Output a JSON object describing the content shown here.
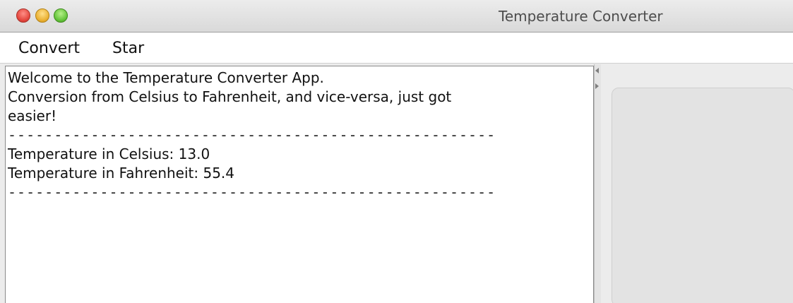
{
  "window": {
    "title": "Temperature Converter",
    "buttons": [
      "close",
      "minimize",
      "zoom"
    ],
    "colors": {
      "close": "#e3453c",
      "minimize": "#eab032",
      "zoom": "#63c33a"
    }
  },
  "menubar": {
    "items": [
      {
        "label": "Convert"
      },
      {
        "label": "Star"
      }
    ]
  },
  "output": {
    "lines": [
      "Welcome to the Temperature Converter App.",
      "Conversion from Celsius to Fahrenheit, and vice-versa, just got",
      "easier!",
      "-----------------------------------------------------",
      "Temperature in Celsius: 13.0",
      "Temperature in Fahrenheit: 55.4",
      "-----------------------------------------------------"
    ]
  },
  "splitpane": {
    "icons": [
      "collapse-left-arrow-icon",
      "expand-right-arrow-icon"
    ]
  }
}
